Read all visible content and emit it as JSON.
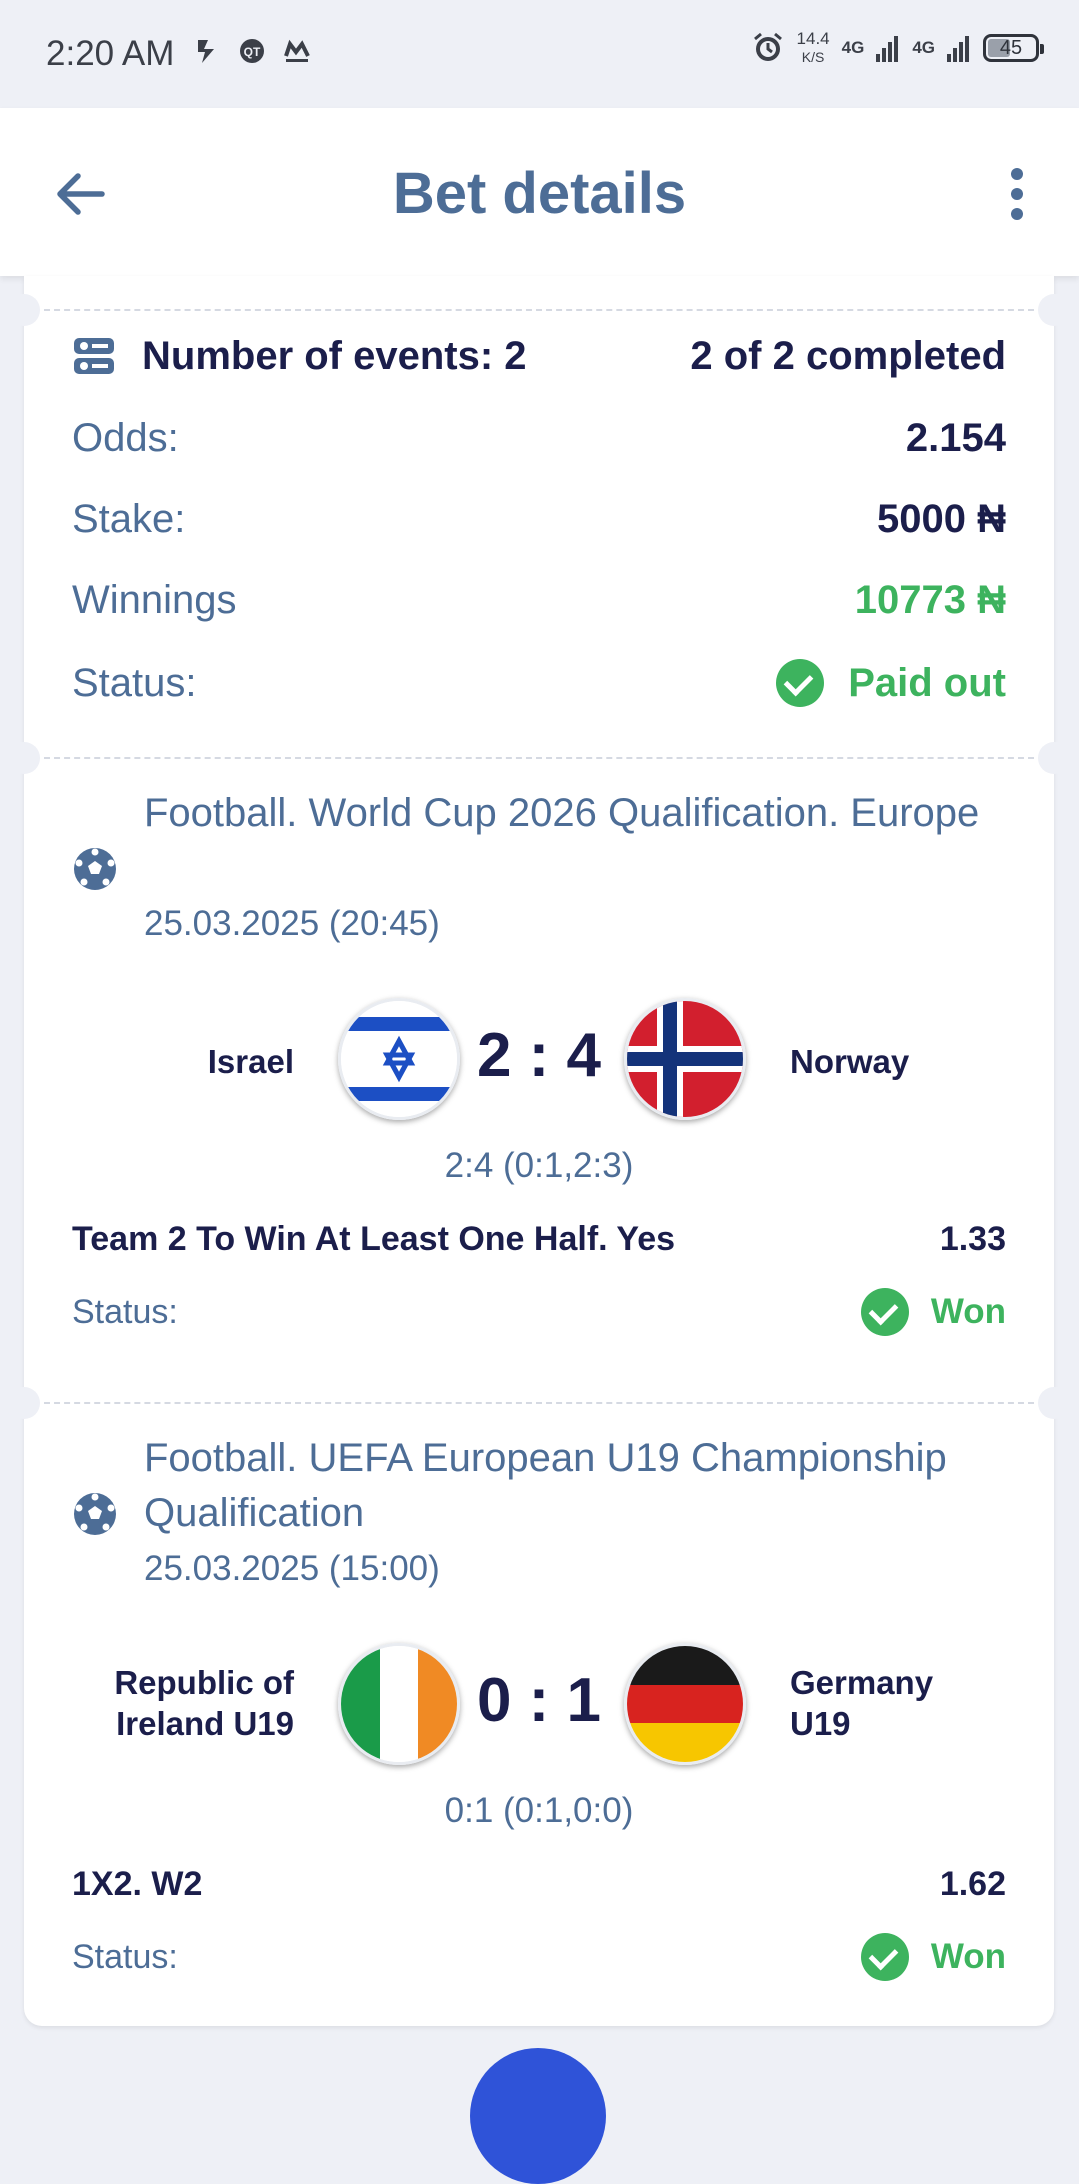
{
  "status_bar": {
    "time": "2:20 AM",
    "speed_value": "14.4",
    "speed_unit": "K/S",
    "net1": "4G",
    "net2": "4G",
    "battery": "45"
  },
  "header": {
    "title": "Bet details"
  },
  "summary": {
    "events_label": "Number of events: 2",
    "completed": "2 of 2 completed",
    "odds_label": "Odds:",
    "odds_value": "2.154",
    "stake_label": "Stake:",
    "stake_value": "5000 ₦",
    "winnings_label": "Winnings",
    "winnings_value": "10773 ₦",
    "status_label": "Status:",
    "status_value": "Paid out"
  },
  "events": [
    {
      "title": "Football. World Cup 2026 Qualification. Europe",
      "date": "25.03.2025 (20:45)",
      "team1": "Israel",
      "team2": "Norway",
      "score": "2 : 4",
      "detail": "2:4 (0:1,2:3)",
      "market": "Team 2 To Win At Least One Half. Yes",
      "odds": "1.33",
      "status_label": "Status:",
      "status": "Won"
    },
    {
      "title": "Football. UEFA European U19 Championship Qualification",
      "date": "25.03.2025 (15:00)",
      "team1": "Republic of Ireland U19",
      "team2": "Germany U19",
      "score": "0 : 1",
      "detail": "0:1 (0:1,0:0)",
      "market": "1X2. W2",
      "odds": "1.62",
      "status_label": "Status:",
      "status": "Won"
    }
  ],
  "colors": {
    "accent": "#4d6d96",
    "dark": "#1b1e4b",
    "success": "#3db35e",
    "fab": "#2f53d8"
  },
  "icons": [
    "back-arrow-icon",
    "more-vert-icon",
    "events-list-icon",
    "check-circle-icon",
    "soccer-ball-icon",
    "alarm-icon",
    "signal-icon",
    "battery-icon"
  ]
}
